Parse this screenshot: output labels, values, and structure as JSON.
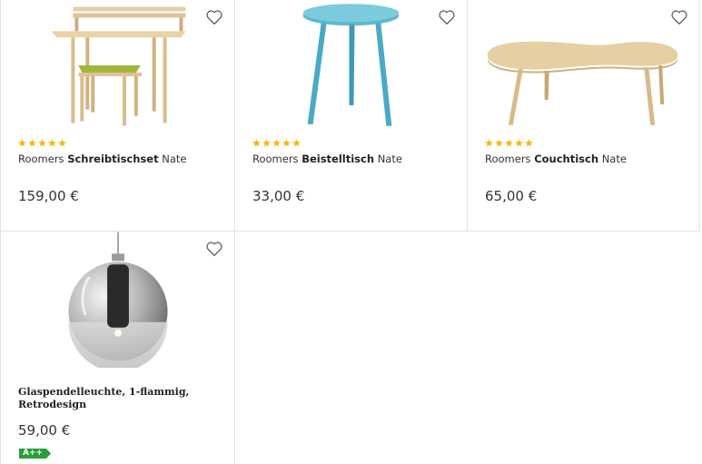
{
  "products": [
    {
      "brand": "Roomers",
      "name": "Schreibtischset",
      "suffix": "Nate",
      "price": "159,00 €",
      "rating": 5,
      "image": "desk-set-image"
    },
    {
      "brand": "Roomers",
      "name": "Beistelltisch",
      "suffix": "Nate",
      "price": "33,00 €",
      "rating": 5,
      "image": "side-table-image"
    },
    {
      "brand": "Roomers",
      "name": "Couchtisch",
      "suffix": "Nate",
      "price": "65,00 €",
      "rating": 5,
      "image": "coffee-table-image"
    },
    {
      "title": "Glaspendelleuchte, 1-flammig, Retrodesign",
      "price": "59,00 €",
      "energy_label": "A++",
      "image": "pendant-lamp-image"
    }
  ],
  "colors": {
    "star": "#f5b400",
    "energy_green": "#2a9d3a",
    "border": "#e2e2e2"
  },
  "icons": {
    "wishlist": "heart-outline-icon"
  }
}
